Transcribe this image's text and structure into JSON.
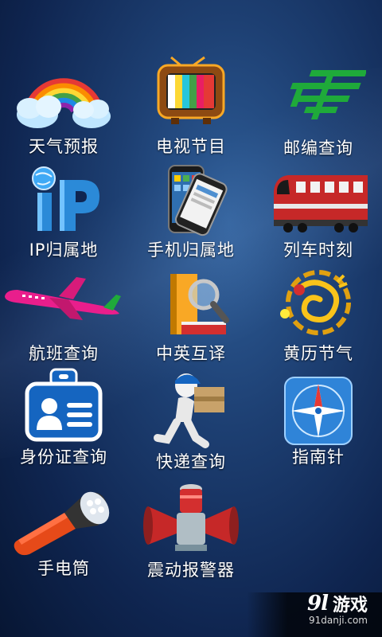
{
  "tiles": [
    {
      "label": "天气预报",
      "icon": "rainbow-cloud-icon"
    },
    {
      "label": "电视节目",
      "icon": "tv-icon"
    },
    {
      "label": "邮编查询",
      "icon": "post-logo-icon"
    },
    {
      "label": "IP归属地",
      "icon": "ip-icon"
    },
    {
      "label": "手机归属地",
      "icon": "phone-icon"
    },
    {
      "label": "列车时刻",
      "icon": "train-icon"
    },
    {
      "label": "航班查询",
      "icon": "airplane-icon"
    },
    {
      "label": "中英互译",
      "icon": "dictionary-icon"
    },
    {
      "label": "黄历节气",
      "icon": "dragon-icon"
    },
    {
      "label": "身份证查询",
      "icon": "id-card-icon"
    },
    {
      "label": "快递查询",
      "icon": "courier-icon"
    },
    {
      "label": "指南针",
      "icon": "compass-icon"
    },
    {
      "label": "手电筒",
      "icon": "flashlight-icon"
    },
    {
      "label": "震动报警器",
      "icon": "alarm-icon"
    }
  ],
  "watermark": {
    "logo": "9l",
    "name": "游戏",
    "domain": "91danji.com"
  },
  "colors": {
    "background": "#1d3f72",
    "text": "#ffffff"
  }
}
